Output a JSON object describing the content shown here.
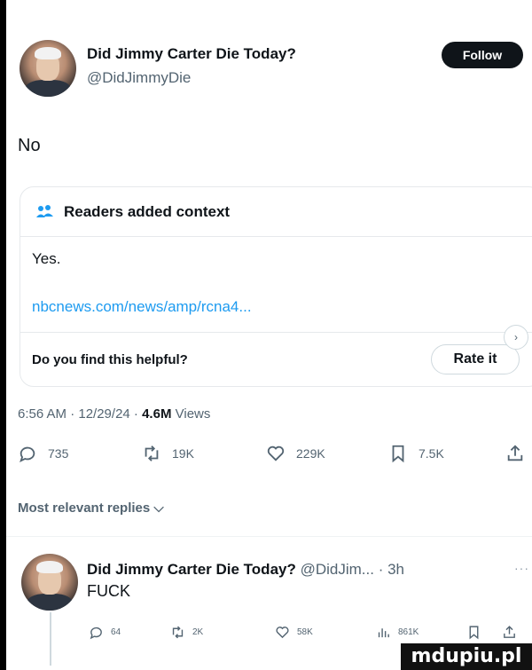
{
  "tweet": {
    "author_name": "Did Jimmy Carter Die Today?",
    "author_handle": "@DidJimmyDie",
    "follow_label": "Follow",
    "text": "No",
    "timestamp": "6:56 AM · 12/29/24 ·",
    "views_count": "4.6M",
    "views_label": "Views",
    "actions": {
      "replies": "735",
      "reposts": "19K",
      "likes": "229K",
      "bookmarks": "7.5K"
    },
    "icons": [
      "reply-icon",
      "repost-icon",
      "like-icon",
      "bookmark-icon",
      "share-icon"
    ]
  },
  "context": {
    "title": "Readers added context",
    "body": "Yes.",
    "link": "nbcnews.com/news/amp/rcna4...",
    "helpful_question": "Do you find this helpful?",
    "rate_label": "Rate it",
    "icon": "people-icon"
  },
  "most_relevant_label": "Most relevant replies ⌵",
  "reply": {
    "author_name": "Did Jimmy Carter Die Today?",
    "handle_time": "@DidJim... · 3h",
    "more": "···",
    "text": "FUCK",
    "actions": {
      "replies": "64",
      "reposts": "2K",
      "likes": "58K",
      "views": "861K"
    }
  },
  "watermark": "mdupiu.pl",
  "colors": {
    "accent_link": "#1d9bf0",
    "text_primary": "#0f1419",
    "text_secondary": "#536471",
    "follow_bg": "#0f1419"
  }
}
